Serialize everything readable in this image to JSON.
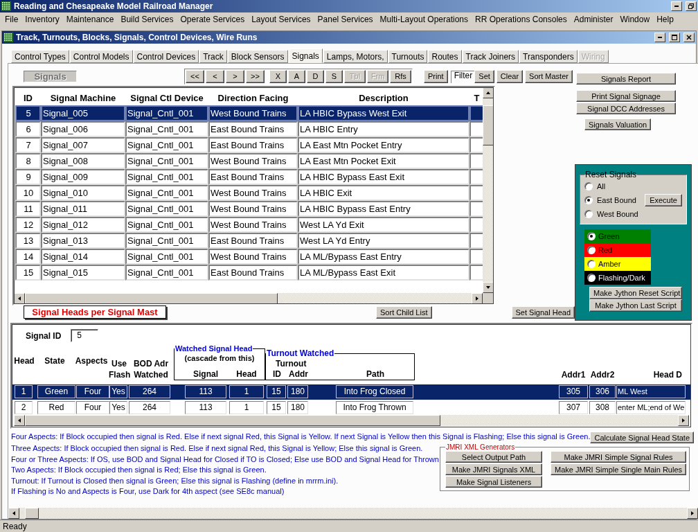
{
  "app_title": "Reading and Chesapeake Model Railroad Manager",
  "menu": [
    "File",
    "Inventory",
    "Maintenance",
    "Build Services",
    "Operate Services",
    "Layout Services",
    "Panel Services",
    "Multi-Layout Operations",
    "RR Operations Consoles",
    "Administer",
    "Window",
    "Help"
  ],
  "window_title": "Track, Turnouts, Blocks, Signals, Control Devices, Wire Runs",
  "tabs": [
    {
      "label": "Control Types",
      "selected": false,
      "disabled": false
    },
    {
      "label": "Control Models",
      "selected": false,
      "disabled": false
    },
    {
      "label": "Control Devices",
      "selected": false,
      "disabled": false
    },
    {
      "label": "Track",
      "selected": false,
      "disabled": false
    },
    {
      "label": "Block Sensors",
      "selected": false,
      "disabled": false
    },
    {
      "label": "Signals",
      "selected": true,
      "disabled": false
    },
    {
      "label": "Lamps, Motors,",
      "selected": false,
      "disabled": false
    },
    {
      "label": "Turnouts",
      "selected": false,
      "disabled": false
    },
    {
      "label": "Routes",
      "selected": false,
      "disabled": false
    },
    {
      "label": "Track Joiners",
      "selected": false,
      "disabled": false
    },
    {
      "label": "Transponders",
      "selected": false,
      "disabled": false
    },
    {
      "label": "Wiring",
      "selected": false,
      "disabled": true
    }
  ],
  "form_label": "Signals",
  "nav_buttons": [
    {
      "label": "<<",
      "disabled": false
    },
    {
      "label": "<",
      "disabled": false
    },
    {
      "label": ">",
      "disabled": false
    },
    {
      "label": ">>",
      "disabled": false
    },
    {
      "label": "X",
      "disabled": false
    },
    {
      "label": "A",
      "disabled": false
    },
    {
      "label": "D",
      "disabled": false
    },
    {
      "label": "S",
      "disabled": false
    },
    {
      "label": "Tbl",
      "disabled": true
    },
    {
      "label": "Frm",
      "disabled": true
    },
    {
      "label": "Rfs",
      "disabled": false
    }
  ],
  "print_button": "Print",
  "filter_label": "Filter",
  "filter_buttons": [
    "Set",
    "Clear"
  ],
  "sort_button": "Sort Master",
  "report_buttons": [
    "Signals Report",
    "Print Signal Signage",
    "Signal DCC Addresses",
    "Signals Valuation"
  ],
  "signals_table": {
    "columns": [
      "ID",
      "Signal Machine",
      "Signal Ctl Device",
      "Direction Facing",
      "Description",
      "T"
    ],
    "rows": [
      {
        "selected": true,
        "cells": [
          "5",
          "Signal_005",
          "Signal_Cntl_001",
          "West Bound Trains",
          "LA HBIC Bypass West Exit"
        ]
      },
      {
        "selected": false,
        "cells": [
          "6",
          "Signal_006",
          "Signal_Cntl_001",
          "East Bound Trains",
          "LA HBIC Entry"
        ]
      },
      {
        "selected": false,
        "cells": [
          "7",
          "Signal_007",
          "Signal_Cntl_001",
          "East Bound Trains",
          "LA East Mtn Pocket Entry"
        ]
      },
      {
        "selected": false,
        "cells": [
          "8",
          "Signal_008",
          "Signal_Cntl_001",
          "West Bound Trains",
          "LA East Mtn Pocket Exit"
        ]
      },
      {
        "selected": false,
        "cells": [
          "9",
          "Signal_009",
          "Signal_Cntl_001",
          "East Bound Trains",
          "LA HBIC Bypass East Exit"
        ]
      },
      {
        "selected": false,
        "cells": [
          "10",
          "Signal_010",
          "Signal_Cntl_001",
          "West Bound Trains",
          "LA HBIC Exit"
        ]
      },
      {
        "selected": false,
        "cells": [
          "11",
          "Signal_011",
          "Signal_Cntl_001",
          "West Bound Trains",
          "LA HBIC Bypass East Entry"
        ]
      },
      {
        "selected": false,
        "cells": [
          "12",
          "Signal_012",
          "Signal_Cntl_001",
          "West Bound Trains",
          "West LA Yd Exit"
        ]
      },
      {
        "selected": false,
        "cells": [
          "13",
          "Signal_013",
          "Signal_Cntl_001",
          "East Bound Trains",
          "West LA Yd Entry"
        ]
      },
      {
        "selected": false,
        "cells": [
          "14",
          "Signal_014",
          "Signal_Cntl_001",
          "West Bound Trains",
          "LA ML/Bypass East Entry"
        ]
      },
      {
        "selected": false,
        "cells": [
          "15",
          "Signal_015",
          "Signal_Cntl_001",
          "East Bound Trains",
          "LA ML/Bypass East Exit"
        ]
      }
    ]
  },
  "reset_panel": {
    "title": "Reset Signals",
    "options": [
      {
        "label": "All",
        "selected": false
      },
      {
        "label": "East Bound",
        "selected": true
      },
      {
        "label": "West Bound",
        "selected": false
      }
    ],
    "execute": "Execute",
    "colors": [
      {
        "label": "Green",
        "color": "#008000",
        "selected": true
      },
      {
        "label": "Red",
        "color": "#ff0000",
        "selected": false
      },
      {
        "label": "Amber",
        "color": "#ffff00",
        "selected": false
      },
      {
        "label": "Flashing/Dark",
        "color": "#000000",
        "selected": false
      }
    ],
    "scripts": [
      "Make Jython Reset Script",
      "Make Jython Last Script"
    ]
  },
  "subform": {
    "title": "Signal Heads per Signal Mast",
    "sort_button": "Sort Child List",
    "set_button": "Set Signal Head",
    "signal_id_label": "Signal ID",
    "signal_id": "5",
    "headers": [
      "Head",
      "State",
      "Aspects",
      "Use Flash",
      "BOD Adr Watched",
      "Signal",
      "Head",
      "ID",
      "Addr",
      "Path",
      "Addr1",
      "Addr2",
      "Head D"
    ],
    "watched_group": {
      "title": "Watched Signal Head",
      "note": "(cascade from this)"
    },
    "turnout_group": {
      "title": "Turnout Watched",
      "subtitle": "Turnout"
    },
    "rows": [
      {
        "selected": true,
        "cells": [
          "1",
          "Green",
          "Four",
          "Yes",
          "264",
          "113",
          "1",
          "15",
          "180",
          "Into Frog Closed",
          "305",
          "306",
          "ML West"
        ]
      },
      {
        "selected": false,
        "cells": [
          "2",
          "Red",
          "Four",
          "Yes",
          "264",
          "113",
          "1",
          "15",
          "180",
          "Into Frog Thrown",
          "307",
          "308",
          "enter ML;end of We"
        ]
      }
    ]
  },
  "notes": [
    "Four Aspects: If Block occupied then signal is Red. Else if next signal Red, this Signal is Yellow. If next Signal is Yellow then this Signal is Flashing; Else this signal is Green.",
    "Three Aspects: If Block occupied then signal is Red. Else if next signal Red, this Signal is Yellow; Else this signal is Green.",
    "Four or Three Aspects: If OS, use BOD and Signal Head for Closed if TO is Closed; Else use BOD and Signal Head for Thrown",
    "Two Aspects: If Block occupied then signal is Red; Else this signal is Green.",
    "Turnout: If Turnout is Closed then signal is Green; Else this signal is Flashing (define in mrrm.ini).",
    "If Flashing is No and Aspects is Four, use Dark for 4th aspect (see SE8c manual)"
  ],
  "calculate_button": "Calculate Signal Head State",
  "jmri": {
    "title": "JMRI XML Generators",
    "left_buttons": [
      "Select Output Path",
      "Make JMRI Signals XML",
      "Make Signal Listeners"
    ],
    "right_buttons": [
      "Make JMRI Simple Signal Rules",
      "Make JMRI Simple Single Main Rules"
    ]
  },
  "status": "Ready"
}
